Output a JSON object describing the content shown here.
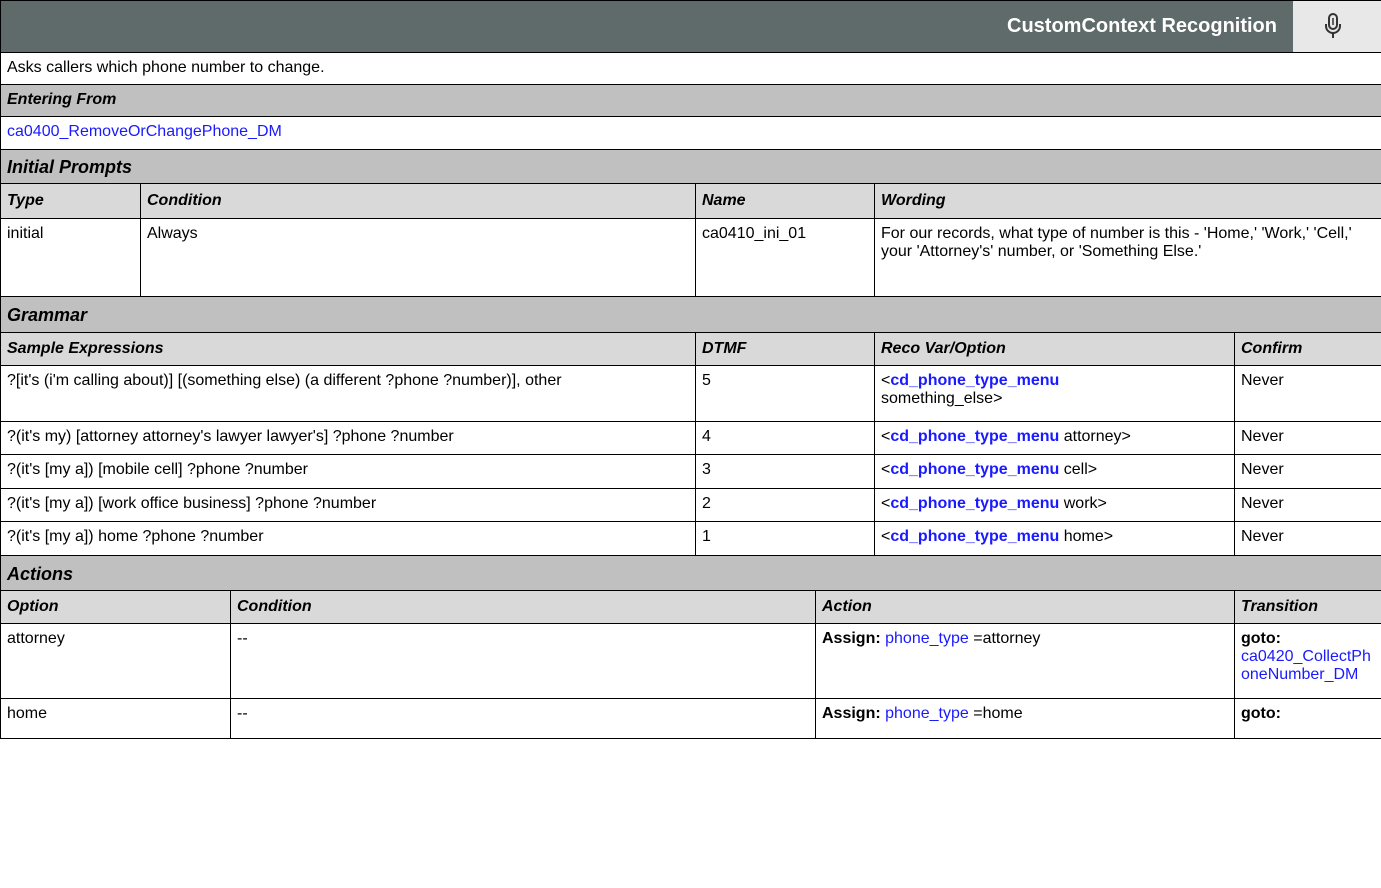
{
  "header": {
    "title": "CustomContext Recognition",
    "mic_icon": "microphone-icon"
  },
  "description": "Asks callers which phone number to change.",
  "entering_from": {
    "label": "Entering From",
    "link": "ca0400_RemoveOrChangePhone_DM"
  },
  "initial_prompts": {
    "label": "Initial Prompts",
    "columns": [
      "Type",
      "Condition",
      "Name",
      "Wording"
    ],
    "rows": [
      {
        "type": "initial",
        "condition": "Always",
        "name": "ca0410_ini_01",
        "wording": "For our records, what type of number is this - 'Home,' 'Work,' 'Cell,' your 'Attorney's' number, or 'Something Else.'"
      }
    ]
  },
  "grammar": {
    "label": "Grammar",
    "columns": [
      "Sample Expressions",
      "DTMF",
      "Reco Var/Option",
      "Confirm"
    ],
    "rows": [
      {
        "expr": "?[it's (i'm calling about)] [(something else) (a different ?phone ?number)], other",
        "dtmf": "5",
        "var": "cd_phone_type_menu",
        "opt": "something_else>",
        "confirm": "Never"
      },
      {
        "expr": "?(it's my) [attorney attorney's lawyer lawyer's]  ?phone ?number",
        "dtmf": "4",
        "var": "cd_phone_type_menu",
        "opt": "attorney>",
        "confirm": "Never"
      },
      {
        "expr": "?(it's [my a]) [mobile cell] ?phone ?number",
        "dtmf": "3",
        "var": "cd_phone_type_menu",
        "opt": "cell>",
        "confirm": "Never"
      },
      {
        "expr": "?(it's [my a]) [work office business]  ?phone ?number",
        "dtmf": "2",
        "var": "cd_phone_type_menu",
        "opt": "work>",
        "confirm": "Never"
      },
      {
        "expr": "?(it's [my a]) home ?phone ?number",
        "dtmf": "1",
        "var": "cd_phone_type_menu",
        "opt": "home>",
        "confirm": "Never"
      }
    ]
  },
  "actions": {
    "label": "Actions",
    "columns": [
      "Option",
      "Condition",
      "Action",
      "Transition"
    ],
    "assign_label": "Assign:",
    "goto_label": "goto:",
    "rows": [
      {
        "option": "attorney",
        "condition": "--",
        "var": "phone_type",
        "value": "=attorney",
        "target": "ca0420_CollectPhoneNumber_DM"
      },
      {
        "option": "home",
        "condition": "--",
        "var": "phone_type",
        "value": "=home",
        "target": ""
      }
    ]
  }
}
